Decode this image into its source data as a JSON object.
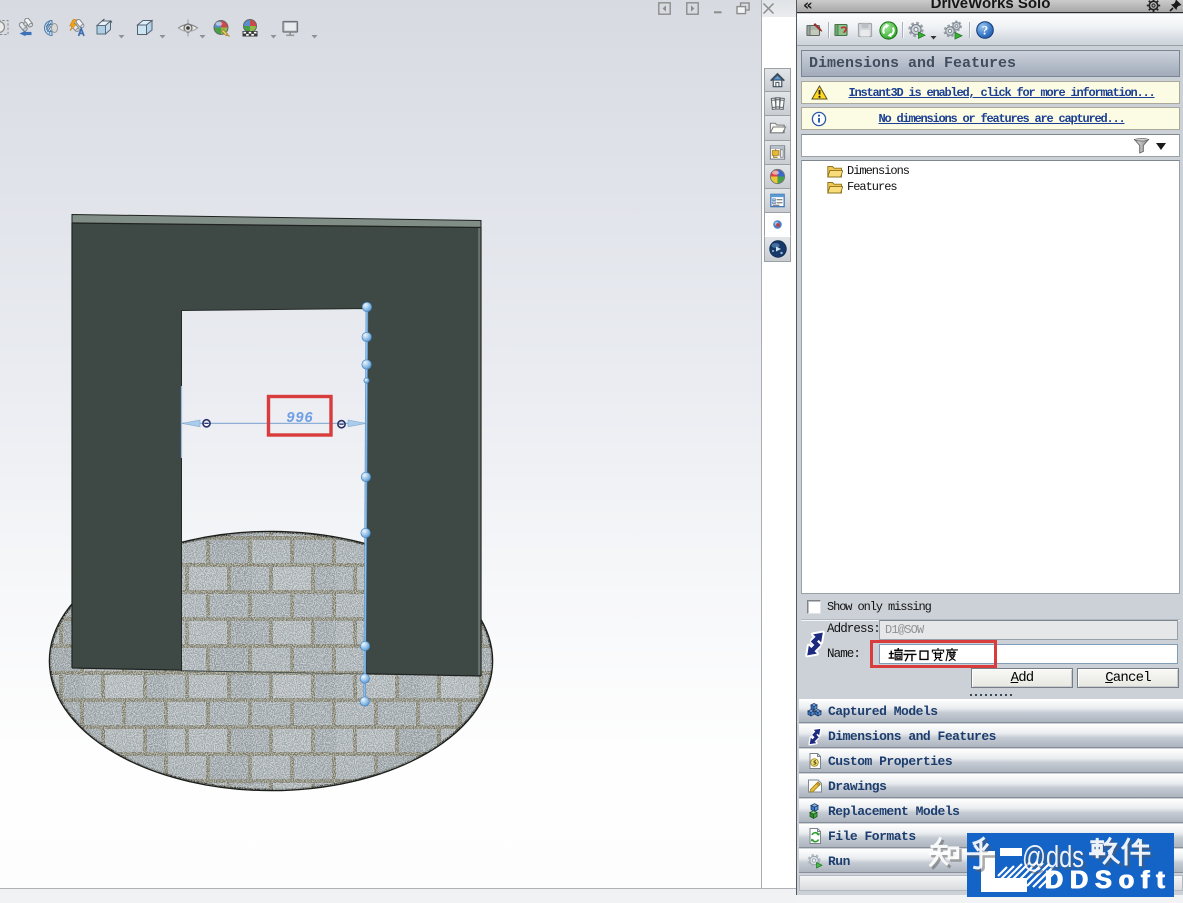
{
  "viewport": {
    "dimension_value": "996",
    "headsup_buttons": [
      "zoom-to-area",
      "previous-view",
      "section-view",
      "dynamic-annotation-views",
      "view-orientation",
      "display-style",
      "hide-show-items",
      "edit-appearance",
      "apply-scene",
      "view-settings"
    ],
    "window_buttons": [
      "previous-document",
      "next-document",
      "minimize",
      "restore",
      "close"
    ]
  },
  "task_pane_tabs": [
    "home",
    "design-library",
    "file-explorer",
    "view-palette",
    "appearances-scenes",
    "custom-properties",
    "solidworks-forum",
    "solidworks-resources"
  ],
  "panel": {
    "collapse_glyph": "«",
    "title": "DriveWorks Solo",
    "toolbar_buttons": [
      "open-project",
      "edit-project",
      "save-project",
      "capture",
      "settings",
      "generate",
      "help"
    ],
    "header": "Dimensions and Features",
    "notices": [
      {
        "icon": "warning",
        "text": "Instant3D is enabled, click for more information..."
      },
      {
        "icon": "info",
        "text": "No dimensions or features are captured..."
      }
    ],
    "tree": [
      {
        "icon": "folder",
        "label": "Dimensions"
      },
      {
        "icon": "folder",
        "label": "Features"
      }
    ],
    "show_only_missing_label": "Show only missing",
    "show_only_missing_checked": false,
    "address_label": "Address:",
    "address_value": "D1@SOW",
    "name_label": "Name:",
    "name_value": "墙开口宽度",
    "add_label": "Add",
    "cancel_label": "Cancel",
    "sections": [
      "Captured Models",
      "Dimensions and Features",
      "Custom Properties",
      "Drawings",
      "Replacement Models",
      "File Formats",
      "Run"
    ]
  },
  "watermark": {
    "text": "知乎 @dds软件",
    "logo_text": "DDSoft"
  },
  "colors": {
    "annotation_red": "#d83c3c",
    "link_navy": "#1b3f92",
    "logo_blue": "#1464c8",
    "section_text": "#1c3d6e",
    "wall": "#3f4947"
  }
}
